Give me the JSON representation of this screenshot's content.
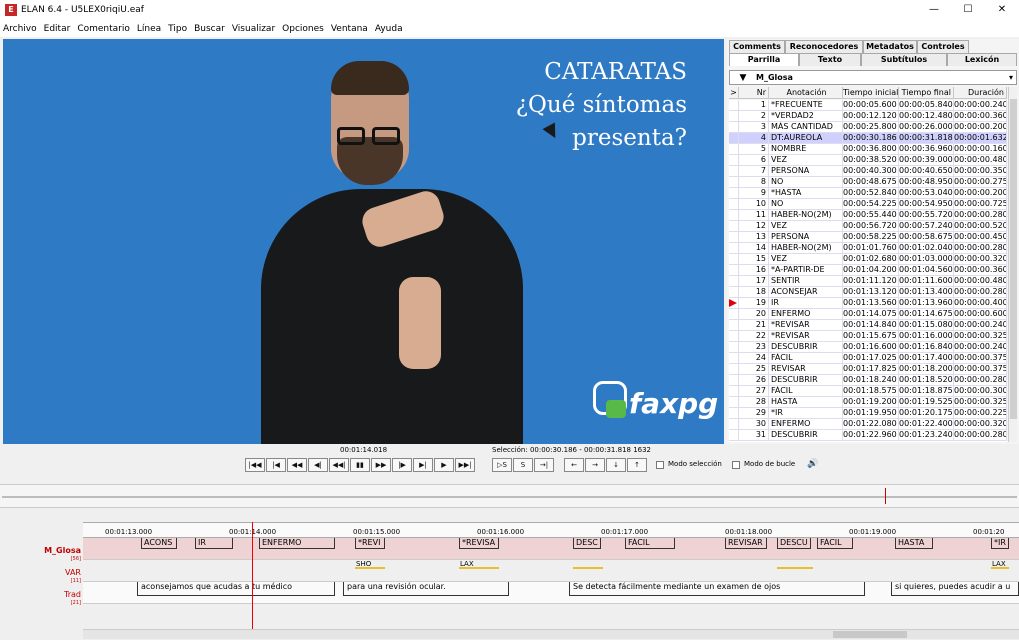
{
  "window": {
    "title": "ELAN 6.4 - U5LEX0riqiU.eaf",
    "icon": "elan-logo-icon",
    "controls": [
      "—",
      "☐",
      "✕"
    ]
  },
  "menu": [
    "Archivo",
    "Editar",
    "Comentario",
    "Línea",
    "Tipo",
    "Buscar",
    "Visualizar",
    "Opciones",
    "Ventana",
    "Ayuda"
  ],
  "video": {
    "title_lines": [
      "CATARATAS",
      "¿Qué síntomas",
      "presenta?"
    ],
    "logo_text": "faxpg"
  },
  "tabs": {
    "row1": [
      "Comments",
      "Reconocedores",
      "Metadatos",
      "Controles"
    ],
    "row2": [
      "Parrilla",
      "Texto",
      "Subtítulos",
      "Lexicón"
    ],
    "active": "Parrilla"
  },
  "tier_selector": {
    "value": "M_Glosa",
    "drop": "▼",
    "chev": "▾"
  },
  "table": {
    "headers": [
      ">",
      "Nr",
      "Anotación",
      "Tiempo inicial",
      "Tiempo final",
      "Duración"
    ],
    "selected_nr": 4,
    "marker_nr": 19,
    "rows": [
      [
        "1",
        "*FRECUENTE",
        "00:00:05.600",
        "00:00:05.840",
        "00:00:00.240"
      ],
      [
        "2",
        "*VERDAD2",
        "00:00:12.120",
        "00:00:12.480",
        "00:00:00.360"
      ],
      [
        "3",
        "MÁS CANTIDAD",
        "00:00:25.800",
        "00:00:26.000",
        "00:00:00.200"
      ],
      [
        "4",
        "DT:AUREOLA",
        "00:00:30.186",
        "00:00:31.818",
        "00:00:01.632"
      ],
      [
        "5",
        "NOMBRE",
        "00:00:36.800",
        "00:00:36.960",
        "00:00:00.160"
      ],
      [
        "6",
        "VEZ",
        "00:00:38.520",
        "00:00:39.000",
        "00:00:00.480"
      ],
      [
        "7",
        "PERSONA",
        "00:00:40.300",
        "00:00:40.650",
        "00:00:00.350"
      ],
      [
        "8",
        "NO",
        "00:00:48.675",
        "00:00:48.950",
        "00:00:00.275"
      ],
      [
        "9",
        "*HASTA",
        "00:00:52.840",
        "00:00:53.040",
        "00:00:00.200"
      ],
      [
        "10",
        "NO",
        "00:00:54.225",
        "00:00:54.950",
        "00:00:00.725"
      ],
      [
        "11",
        "HABER-NO(2M)",
        "00:00:55.440",
        "00:00:55.720",
        "00:00:00.280"
      ],
      [
        "12",
        "VEZ",
        "00:00:56.720",
        "00:00:57.240",
        "00:00:00.520"
      ],
      [
        "13",
        "PERSONA",
        "00:00:58.225",
        "00:00:58.675",
        "00:00:00.450"
      ],
      [
        "14",
        "HABER-NO(2M)",
        "00:01:01.760",
        "00:01:02.040",
        "00:00:00.280"
      ],
      [
        "15",
        "VEZ",
        "00:01:02.680",
        "00:01:03.000",
        "00:00:00.320"
      ],
      [
        "16",
        "*A-PARTIR-DE",
        "00:01:04.200",
        "00:01:04.560",
        "00:00:00.360"
      ],
      [
        "17",
        "SENTIR",
        "00:01:11.120",
        "00:01:11.600",
        "00:00:00.480"
      ],
      [
        "18",
        "ACONSEJAR",
        "00:01:13.120",
        "00:01:13.400",
        "00:00:00.280"
      ],
      [
        "19",
        "IR",
        "00:01:13.560",
        "00:01:13.960",
        "00:00:00.400"
      ],
      [
        "20",
        "ENFERMO",
        "00:01:14.075",
        "00:01:14.675",
        "00:00:00.600"
      ],
      [
        "21",
        "*REVISAR",
        "00:01:14.840",
        "00:01:15.080",
        "00:00:00.240"
      ],
      [
        "22",
        "*REVISAR",
        "00:01:15.675",
        "00:01:16.000",
        "00:00:00.325"
      ],
      [
        "23",
        "DESCUBRIR",
        "00:01:16.600",
        "00:01:16.840",
        "00:00:00.240"
      ],
      [
        "24",
        "FÁCIL",
        "00:01:17.025",
        "00:01:17.400",
        "00:00:00.375"
      ],
      [
        "25",
        "REVISAR",
        "00:01:17.825",
        "00:01:18.200",
        "00:00:00.375"
      ],
      [
        "26",
        "DESCUBRIR",
        "00:01:18.240",
        "00:01:18.520",
        "00:00:00.280"
      ],
      [
        "27",
        "FÁCIL",
        "00:01:18.575",
        "00:01:18.875",
        "00:00:00.300"
      ],
      [
        "28",
        "HASTA",
        "00:01:19.200",
        "00:01:19.525",
        "00:00:00.325"
      ],
      [
        "29",
        "*IR",
        "00:01:19.950",
        "00:01:20.175",
        "00:00:00.225"
      ],
      [
        "30",
        "ENFERMO",
        "00:01:22.080",
        "00:01:22.400",
        "00:00:00.320"
      ],
      [
        "31",
        "DESCUBRIR",
        "00:01:22.960",
        "00:01:23.240",
        "00:00:00.280"
      ]
    ]
  },
  "controls": {
    "current_time": "00:01:14.018",
    "selection": "Selección: 00:00:30.186 - 00:00:31.818  1632",
    "transport": [
      "|◀◀",
      "|◀",
      "◀◀",
      "◀|",
      "◀◀|",
      "▮▮",
      "▶▶",
      "|▶",
      "▶|",
      "▶",
      "▶▶|"
    ],
    "selection_buttons": [
      "▷S",
      "S",
      "→|"
    ],
    "nav_buttons": [
      "←",
      "→",
      "↓",
      "↑"
    ],
    "mode_selection_label": "Modo selección",
    "loop_mode_label": "Modo de bucle",
    "volume_icon": "🔊"
  },
  "timeline": {
    "ruler_labels": [
      "00:01:13.000",
      "00:01:14.000",
      "00:01:15.000",
      "00:01:16.000",
      "00:01:17.000",
      "00:01:18.000",
      "00:01:19.000",
      "00:01:20"
    ],
    "tiers": [
      {
        "name": "M_Glosa",
        "count": "[56]"
      },
      {
        "name": "VAR",
        "count": "[11]"
      },
      {
        "name": "Trad",
        "count": "[21]"
      }
    ],
    "glosa": [
      "ACONS",
      "IR",
      "ENFERMO",
      "*REVI",
      "*REVISA",
      "DESC",
      "FÁCIL",
      "REVISAR",
      "DESCU",
      "FÁCIL",
      "HASTA",
      "*IR"
    ],
    "var": [
      "SHO",
      "LAX",
      "",
      "",
      "LAX"
    ],
    "trad": [
      "aconsejamos que acudas a tu médico",
      "para una revisión ocular.",
      "Se detecta fácilmente mediante un examen de ojos",
      "si quieres, puedes acudir a u"
    ]
  },
  "colors": {
    "video_bg": "#2f7ac5",
    "selected_row": "#d0d0ff",
    "crosshair": "#e00000",
    "glosa_label": "#c00000",
    "var_line": "#e6c030"
  }
}
